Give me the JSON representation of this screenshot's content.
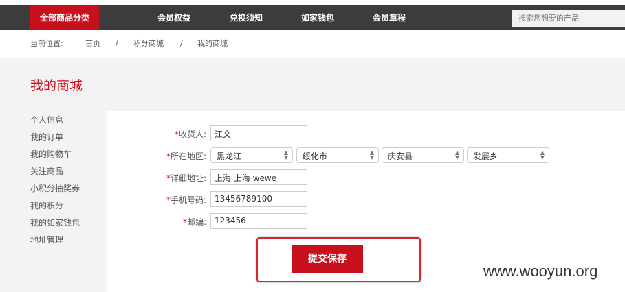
{
  "nav": {
    "all_categories": "全部商品分类",
    "items": [
      "会员权益",
      "兑换须知",
      "如家钱包",
      "会员章程"
    ],
    "search_placeholder": "搜索您想要的产品"
  },
  "breadcrumb": {
    "label": "当前位置:",
    "items": [
      "首页",
      "积分商城",
      "我的商城"
    ],
    "separator": "/"
  },
  "page_title": "我的商城",
  "sidebar": [
    "个人信息",
    "我的订单",
    "我的购物车",
    "关注商品",
    "小积分抽奖券",
    "我的积分",
    "我的如家钱包",
    "地址管理"
  ],
  "form": {
    "required_mark": "*",
    "receiver_label": "收货人:",
    "receiver": "江文",
    "region_label": "所在地区:",
    "province": "黑龙江",
    "city": "绥化市",
    "county": "庆安县",
    "town": "发展乡",
    "address_label": "详细地址:",
    "address": "上海 上海 wewe",
    "phone_label": "手机号码:",
    "phone": "13456789100",
    "zip_label": "邮编:",
    "zip": "123456",
    "submit": "提交保存"
  },
  "watermark": "www.wooyun.org"
}
